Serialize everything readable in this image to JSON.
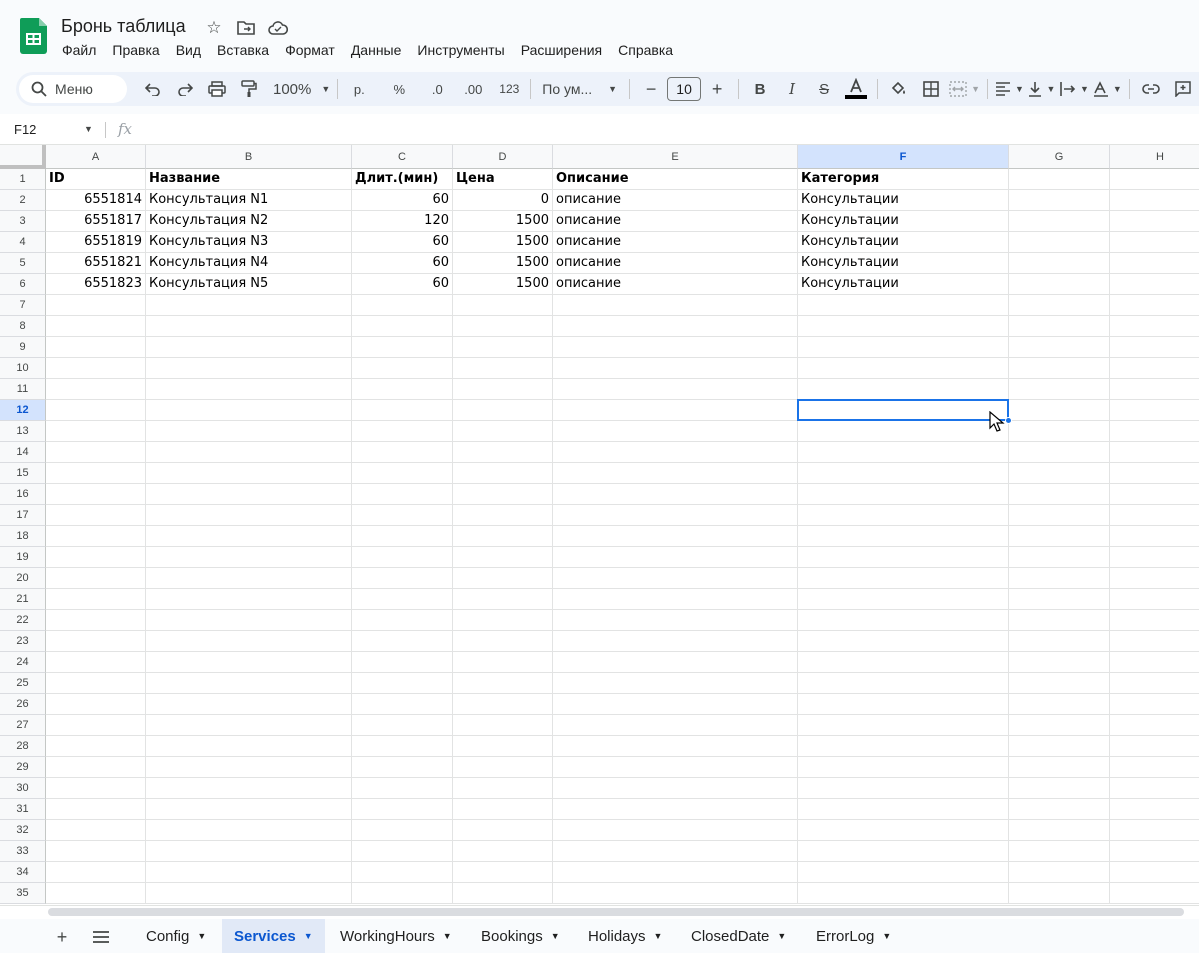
{
  "app": {
    "title": "Бронь таблица",
    "brand_color": "#0f9d58",
    "accent_color": "#1a73e8"
  },
  "menubar": {
    "items": [
      "Файл",
      "Правка",
      "Вид",
      "Вставка",
      "Формат",
      "Данные",
      "Инструменты",
      "Расширения",
      "Справка"
    ]
  },
  "toolbar": {
    "search_label": "Меню",
    "zoom": "100%",
    "currency": "р.",
    "percent": "%",
    "dec_decrease": ".0",
    "dec_increase": ".00",
    "number_format": "123",
    "font_name": "По ум...",
    "font_size": "10"
  },
  "formula_bar": {
    "name_box": "F12",
    "fx": "fx",
    "value": ""
  },
  "grid": {
    "columns": [
      "A",
      "B",
      "C",
      "D",
      "E",
      "F",
      "G",
      "H"
    ],
    "active_column": "F",
    "active_row": 12,
    "row_count": 35,
    "rows": [
      [
        "ID",
        "Название",
        "Длит.(мин)",
        "Цена",
        "Описание",
        "Категория"
      ],
      [
        "6551814",
        "Консультация N1",
        "60",
        "0",
        "описание",
        "Консультации"
      ],
      [
        "6551817",
        "Консультация N2",
        "120",
        "1500",
        "описание",
        "Консультации"
      ],
      [
        "6551819",
        "Консультация N3",
        "60",
        "1500",
        "описание",
        "Консультации"
      ],
      [
        "6551821",
        "Консультация N4",
        "60",
        "1500",
        "описание",
        "Консультации"
      ],
      [
        "6551823",
        "Консультация N5",
        "60",
        "1500",
        "описание",
        "Консультации"
      ]
    ]
  },
  "sheets": {
    "tabs": [
      "Config",
      "Services",
      "WorkingHours",
      "Bookings",
      "Holidays",
      "ClosedDate",
      "ErrorLog"
    ],
    "active": "Services"
  }
}
